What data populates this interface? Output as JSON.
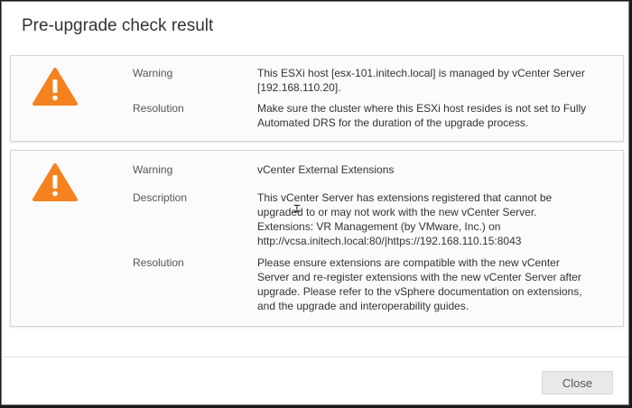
{
  "dialog": {
    "title": "Pre-upgrade check result",
    "close_label": "Close"
  },
  "colors": {
    "warning": "#f5821f",
    "button_bg": "#e9e9e9"
  },
  "results": [
    {
      "icon": "warning-triangle-icon",
      "rows": [
        {
          "label": "Warning",
          "lines": [
            "This ESXi host [esx-101.initech.local] is managed by vCenter Server",
            "[192.168.110.20]."
          ]
        },
        {
          "label": "Resolution",
          "lines": [
            "Make sure the cluster where this ESXi host resides is not set to Fully",
            "Automated DRS for the duration of the upgrade process."
          ]
        }
      ]
    },
    {
      "icon": "warning-triangle-icon",
      "rows": [
        {
          "label": "Warning",
          "lines": [
            "vCenter External Extensions"
          ]
        },
        {
          "label": "Description",
          "lines": [
            "This vCenter Server has extensions registered that cannot be",
            "upgraded to or may not work with the new vCenter Server.",
            "Extensions: VR Management (by VMware, Inc.) on",
            "http://vcsa.initech.local:80/|https://192.168.110.15:8043"
          ]
        },
        {
          "label": "Resolution",
          "lines": [
            "Please ensure extensions are compatible with the new vCenter",
            "Server and re-register extensions with the new vCenter Server after",
            "upgrade. Please refer to the vSphere documentation on extensions,",
            "and the upgrade and interoperability guides."
          ]
        }
      ]
    }
  ]
}
